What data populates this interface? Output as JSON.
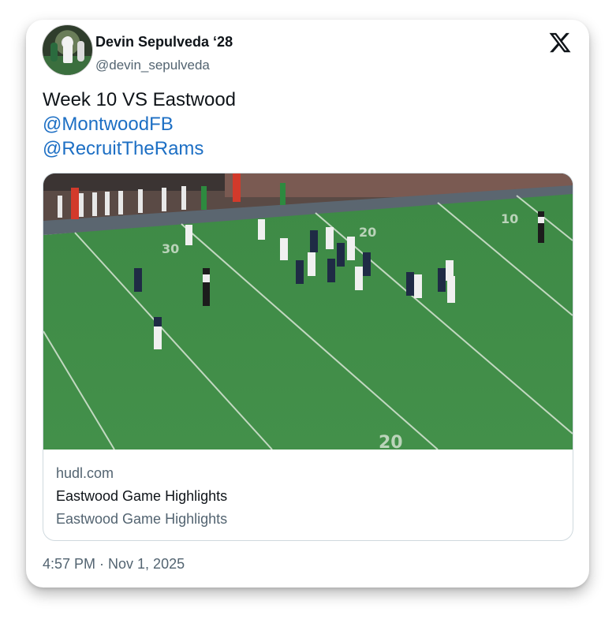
{
  "author": {
    "name": "Devin Sepulveda ‘28",
    "handle": "@devin_sepulveda"
  },
  "tweet": {
    "text": "Week 10 VS Eastwood",
    "mentions": [
      "@MontwoodFB",
      "@RecruitTheRams"
    ]
  },
  "link_card": {
    "domain": "hudl.com",
    "title": "Eastwood Game Highlights",
    "description": "Eastwood Game Highlights",
    "media_semantic": "football-game-still"
  },
  "timestamp": "4:57 PM · Nov 1, 2025",
  "icons": {
    "brand": "x-logo-icon"
  },
  "colors": {
    "mention": "#1d6fc4",
    "secondary_text": "#536471",
    "primary_text": "#0f1419",
    "turf": "#3f8a45"
  }
}
